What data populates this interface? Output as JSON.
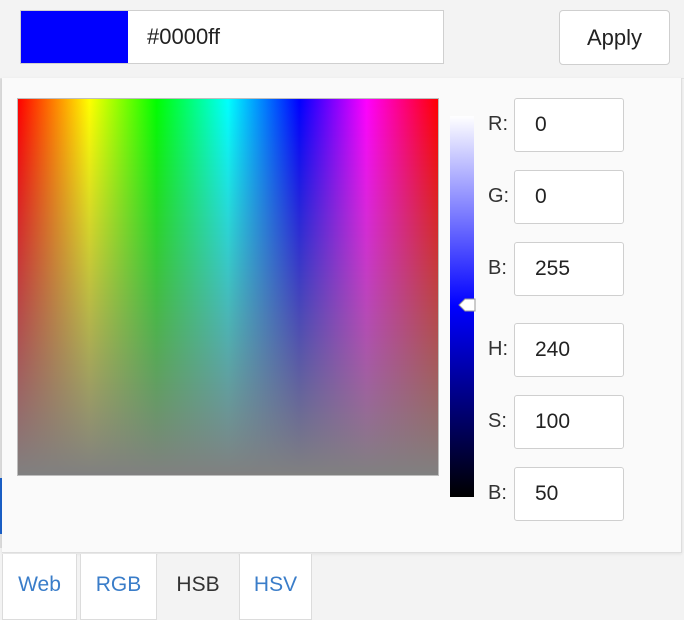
{
  "color": {
    "hex": "#0000ff",
    "swatch_color": "#0000ff",
    "apply_label": "Apply"
  },
  "picker": {
    "hue_color": "#0000ff",
    "brightness_level_percent": 50
  },
  "fields": {
    "r_label": "R:",
    "r_value": "0",
    "g_label": "G:",
    "g_value": "0",
    "b_label": "B:",
    "b_value": "255",
    "h_label": "H:",
    "h_value": "240",
    "s_label": "S:",
    "s_value": "100",
    "b2_label": "B:",
    "b2_value": "50"
  },
  "tabs": {
    "web": "Web",
    "rgb": "RGB",
    "hsb": "HSB",
    "hsv": "HSV",
    "active": "HSB"
  },
  "colors": {
    "tab_link": "#3a7dc9",
    "accent_edge": "#1a5fc8"
  }
}
